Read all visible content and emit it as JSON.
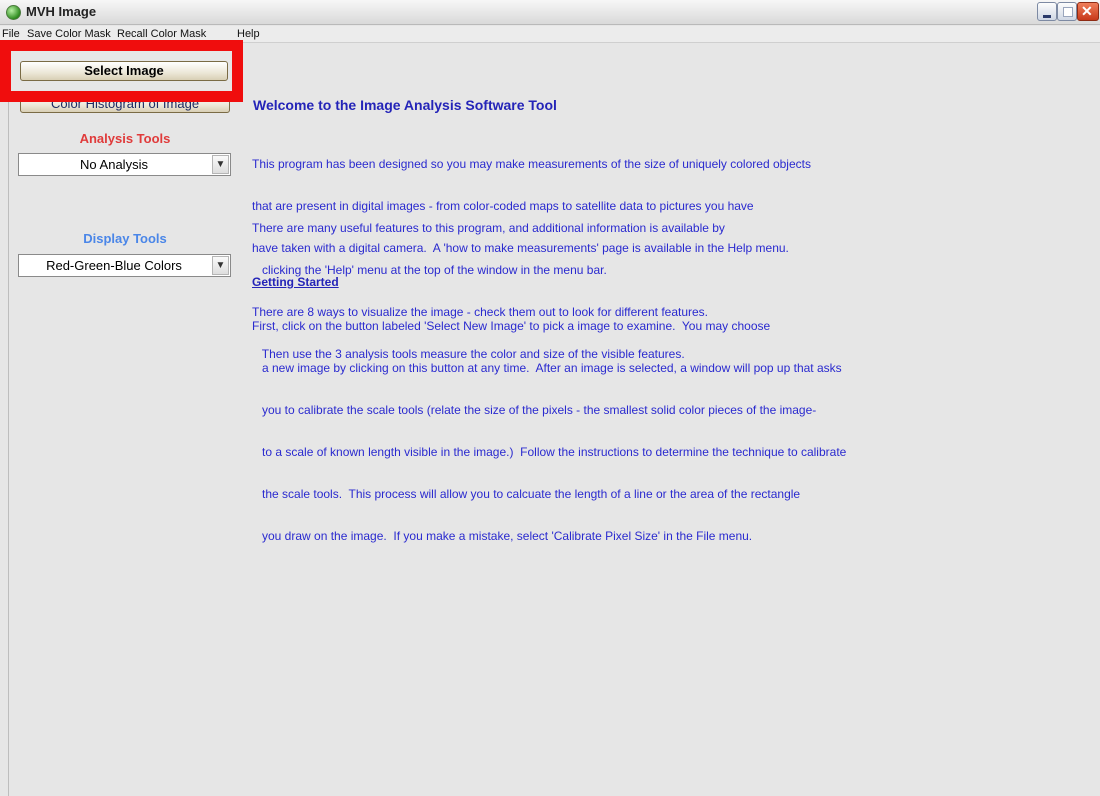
{
  "window": {
    "title": "MVH Image"
  },
  "menu": [
    "File",
    "Save Color Mask",
    "Recall Color Mask",
    "Help"
  ],
  "left_panel": {
    "select_image_label": "Select Image",
    "histogram_label": "Color Histogram of Image",
    "analysis_tools_label": "Analysis Tools",
    "analysis_selected": "No Analysis",
    "display_tools_label": "Display Tools",
    "display_selected": "Red-Green-Blue Colors"
  },
  "main": {
    "welcome_title": "Welcome to the Image Analysis Software Tool",
    "intro_lines": [
      "This program has been designed so you may make measurements of the size of uniquely colored objects",
      "that are present in digital images - from color-coded maps to satellite data to pictures you have",
      "have taken with a digital camera.  A 'how to make measurements' page is available in the Help menu."
    ],
    "features_lines": [
      "There are many useful features to this program, and additional information is available by",
      "   clicking the 'Help' menu at the top of the window in the menu bar.",
      "There are 8 ways to visualize the image - check them out to look for different features.",
      "   Then use the 3 analysis tools measure the color and size of the visible features."
    ],
    "getting_started_heading": "Getting Started",
    "getting_started_lines": [
      "First, click on the button labeled 'Select New Image' to pick a image to examine.  You may choose",
      "   a new image by clicking on this button at any time.  After an image is selected, a window will pop up that asks",
      "   you to calibrate the scale tools (relate the size of the pixels - the smallest solid color pieces of the image-",
      "   to a scale of known length visible in the image.)  Follow the instructions to determine the technique to calibrate",
      "   the scale tools.  This process will allow you to calcuate the length of a line or the area of the rectangle",
      "   you draw on the image.  If you make a mistake, select 'Calibrate Pixel Size' in the File menu."
    ]
  },
  "colors": {
    "highlight": "#f00d0d",
    "text_blue": "#2a2acf",
    "analysis_label": "#e03b3b",
    "display_label": "#4a86e8"
  },
  "icons": [
    "app-icon",
    "minimize-icon",
    "maximize-icon",
    "close-icon",
    "chevron-down-icon"
  ]
}
